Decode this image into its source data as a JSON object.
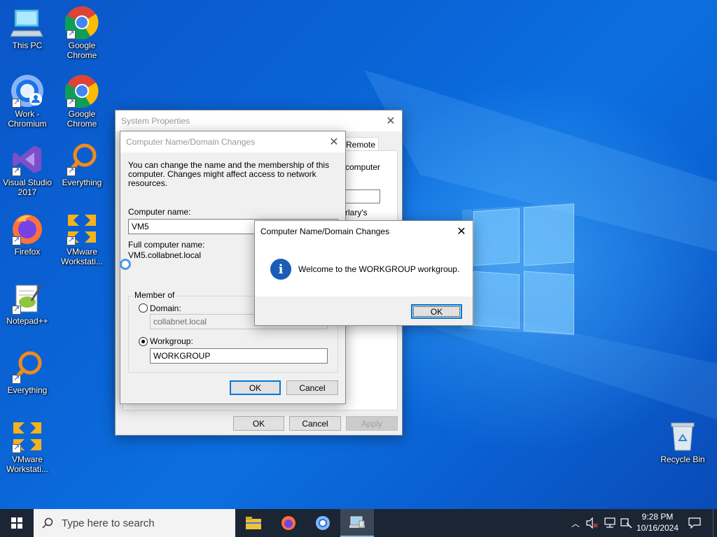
{
  "desktop": {
    "icons": [
      {
        "label": "This PC"
      },
      {
        "label": "Google Chrome"
      },
      {
        "label": "Work - Chromium"
      },
      {
        "label": "Google Chrome"
      },
      {
        "label": "Visual Studio 2017"
      },
      {
        "label": "Everything"
      },
      {
        "label": "Firefox"
      },
      {
        "label": "VMware Workstati..."
      },
      {
        "label": "Notepad++"
      },
      {
        "label": "Everything"
      },
      {
        "label": "VMware Workstati..."
      },
      {
        "label": "Recycle Bin"
      }
    ]
  },
  "system_properties": {
    "title": "System Properties",
    "tab_remote": "Remote",
    "partial_text_1": "computer",
    "partial_text_2": "rlary's",
    "ok": "OK",
    "cancel": "Cancel",
    "apply": "Apply"
  },
  "domain_changes": {
    "title": "Computer Name/Domain Changes",
    "intro": "You can change the name and the membership of this computer. Changes might affect access to network resources.",
    "computer_name_label": "Computer name:",
    "computer_name_value": "VM5",
    "full_name_label": "Full computer name:",
    "full_name_value": "VM5.collabnet.local",
    "member_of": "Member of",
    "domain_label": "Domain:",
    "domain_value": "collabnet.local",
    "workgroup_label": "Workgroup:",
    "workgroup_value": "WORKGROUP",
    "ok": "OK",
    "cancel": "Cancel"
  },
  "message_box": {
    "title": "Computer Name/Domain Changes",
    "message": "Welcome to the WORKGROUP workgroup.",
    "ok": "OK",
    "icon": "info-icon"
  },
  "taskbar": {
    "search_placeholder": "Type here to search",
    "time": "9:28 PM",
    "date": "10/16/2024"
  },
  "colors": {
    "accent": "#0078d7",
    "taskbar": "#1c2533",
    "desktop": "#0a64d6"
  }
}
